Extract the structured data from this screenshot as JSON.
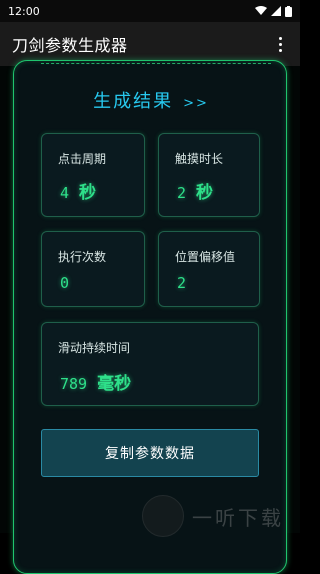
{
  "status_bar": {
    "time": "12:00"
  },
  "app_bar": {
    "title": "刀剑参数生成器"
  },
  "section": {
    "title": "生成结果",
    "arrow": ">>"
  },
  "results": {
    "click_period": {
      "label": "点击周期",
      "value": "4",
      "unit": "秒"
    },
    "touch_duration": {
      "label": "触摸时长",
      "value": "2",
      "unit": "秒"
    },
    "execution_count": {
      "label": "执行次数",
      "value": "0"
    },
    "position_offset": {
      "label": "位置偏移值",
      "value": "2"
    },
    "slide_duration": {
      "label": "滑动持续时间",
      "value": "789",
      "unit": "毫秒"
    }
  },
  "copy_button": {
    "label": "复制参数数据"
  },
  "watermark": {
    "text": "一听下载"
  },
  "colors": {
    "accent_green": "#2ee08a",
    "title_cyan": "#27c8ee",
    "button_bg": "#13434f"
  }
}
